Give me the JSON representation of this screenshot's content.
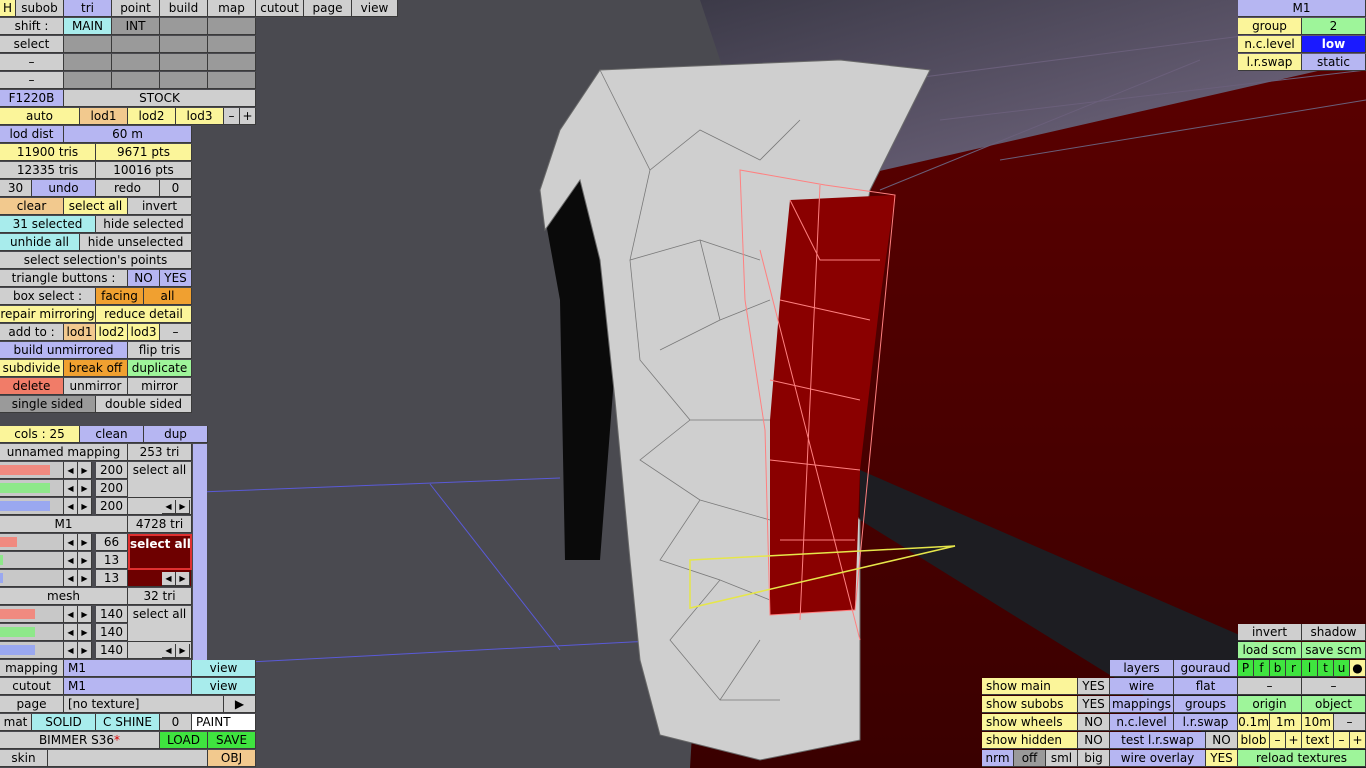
{
  "top_menu": {
    "h": "H",
    "subob": "subob",
    "tri": "tri",
    "point": "point",
    "build": "build",
    "map": "map",
    "cutout": "cutout",
    "page": "page",
    "view": "view"
  },
  "shift": {
    "label": "shift :",
    "main": "MAIN",
    "int": "INT"
  },
  "select_row": {
    "label": "select"
  },
  "dash_rows": [
    "–",
    "–"
  ],
  "car": {
    "code": "F1220B",
    "variant": "STOCK"
  },
  "lods": {
    "auto": "auto",
    "lod1": "lod1",
    "lod2": "lod2",
    "lod3": "lod3",
    "minus": "–",
    "plus": "+"
  },
  "lod_dist": {
    "label": "lod dist",
    "value": "60 m"
  },
  "stats": {
    "tris1": "11900 tris",
    "pts1": "9671 pts",
    "tris2": "12335 tris",
    "pts2": "10016 pts"
  },
  "undo_row": {
    "count": "30",
    "undo": "undo",
    "redo": "redo",
    "redo_count": "0"
  },
  "ops": {
    "clear": "clear",
    "select_all": "select all",
    "invert": "invert",
    "selected": "31 selected",
    "hide_selected": "hide selected",
    "unhide_all": "unhide all",
    "hide_unselected": "hide unselected",
    "select_points": "select selection's points",
    "tri_buttons": "triangle buttons :",
    "no": "NO",
    "yes": "YES",
    "box_select": "box select :",
    "facing": "facing",
    "all": "all",
    "repair_mirroring": "repair mirroring",
    "reduce_detail": "reduce detail",
    "add_to": "add to :",
    "lod1": "lod1",
    "lod2": "lod2",
    "lod3": "lod3",
    "dash": "–",
    "build_unmirrored": "build unmirrored",
    "flip_tris": "flip tris",
    "subdivide": "subdivide",
    "break_off": "break off",
    "duplicate": "duplicate",
    "delete": "delete",
    "unmirror": "unmirror",
    "mirror": "mirror",
    "single_sided": "single sided",
    "double_sided": "double sided"
  },
  "cols": {
    "label": "cols : 25",
    "clean": "clean",
    "dup": "dup"
  },
  "mappings": [
    {
      "name": "unnamed mapping",
      "tris": "253 tri",
      "vals": [
        "200",
        "200",
        "200"
      ],
      "action": "select all",
      "active": false
    },
    {
      "name": "M1",
      "tris": "4728 tri",
      "vals": [
        "66",
        "13",
        "13"
      ],
      "action": "select all",
      "active": true
    },
    {
      "name": "mesh",
      "tris": "32 tri",
      "vals": [
        "140",
        "140",
        "140"
      ],
      "action": "select all",
      "active": false
    }
  ],
  "arrows": {
    "left": "◀",
    "right": "▶"
  },
  "bottom": {
    "mapping_label": "mapping",
    "mapping_val": "M1",
    "view": "view",
    "cutout_label": "cutout",
    "cutout_val": "M1",
    "page_label": "page",
    "page_val": "[no texture]",
    "page_arrow": "▶",
    "mat": "mat",
    "solid": "SOLID",
    "cshine": "C SHINE",
    "zero": "0",
    "paint": "PAINT",
    "model": "BIMMER S36",
    "star": "*",
    "load": "LOAD",
    "save": "SAVE",
    "skin": "skin",
    "obj": "OBJ"
  },
  "top_right": {
    "title": "M1",
    "group_label": "group",
    "group_val": "2",
    "nclevel_label": "n.c.level",
    "nclevel_val": "low",
    "lrswap_label": "l.r.swap",
    "lrswap_val": "static"
  },
  "br_right": {
    "invert": "invert",
    "shadow": "shadow",
    "load_scm": "load scm",
    "save_scm": "save scm",
    "letters": [
      "P",
      "f",
      "b",
      "r",
      "l",
      "t",
      "u",
      "●"
    ],
    "dash": "–",
    "origin": "origin",
    "object": "object",
    "d1": "0.1m",
    "d2": "1m",
    "d3": "10m",
    "blob": "blob",
    "text": "text",
    "plus": "+",
    "reload": "reload textures"
  },
  "br_mid": {
    "layers": "layers",
    "gouraud": "gouraud",
    "wire": "wire",
    "flat": "flat",
    "mappings": "mappings",
    "groups": "groups",
    "nc_level": "n.c.level",
    "lr_swap": "l.r.swap",
    "test_lr": "test l.r.swap",
    "no": "NO",
    "wire_overlay": "wire overlay",
    "yes": "YES",
    "big": "big"
  },
  "br_left": {
    "show_main": "show main",
    "show_subobs": "show subobs",
    "show_wheels": "show wheels",
    "show_hidden": "show hidden",
    "yes": "YES",
    "no": "NO",
    "nrm": "nrm",
    "off": "off",
    "sml": "sml"
  },
  "colors": {
    "selection_red": "#8a0000",
    "panel_grey": "#cfcfcf",
    "accent_blue": "#b6b6f2",
    "wire_yellow": "#e6e64a"
  }
}
